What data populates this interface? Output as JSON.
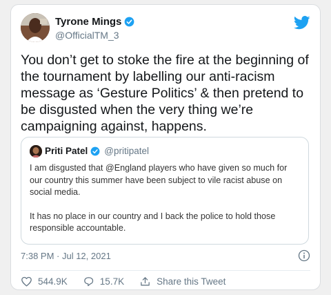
{
  "author": {
    "name": "Tyrone Mings",
    "handle": "@OfficialTM_3"
  },
  "tweet": {
    "text": "You don’t get to stoke the fire at the beginning of the tournament by labelling our anti-racism message as ‘Gesture Politics’ & then pretend to be disgusted when the very thing we’re campaigning against, happens."
  },
  "quoted": {
    "name": "Priti Patel",
    "handle": "@pritipatel",
    "paragraphs": [
      "I am disgusted that @England players who have given so much for our country this summer have been subject to vile racist abuse on social media.",
      "It has no place in our country and I back the police to hold those responsible accountable."
    ]
  },
  "meta": {
    "timestamp": "7:38 PM · Jul 12, 2021"
  },
  "actions": {
    "likes": "544.9K",
    "replies": "15.7K",
    "share_label": "Share this Tweet"
  },
  "icons": {
    "verified": "verified-badge-icon",
    "bird": "twitter-bird-icon",
    "info": "info-icon",
    "like": "heart-icon",
    "reply": "reply-icon",
    "share": "share-icon"
  },
  "colors": {
    "brand": "#1da1f2",
    "secondary_text": "#657786",
    "border": "#cfd9de"
  }
}
